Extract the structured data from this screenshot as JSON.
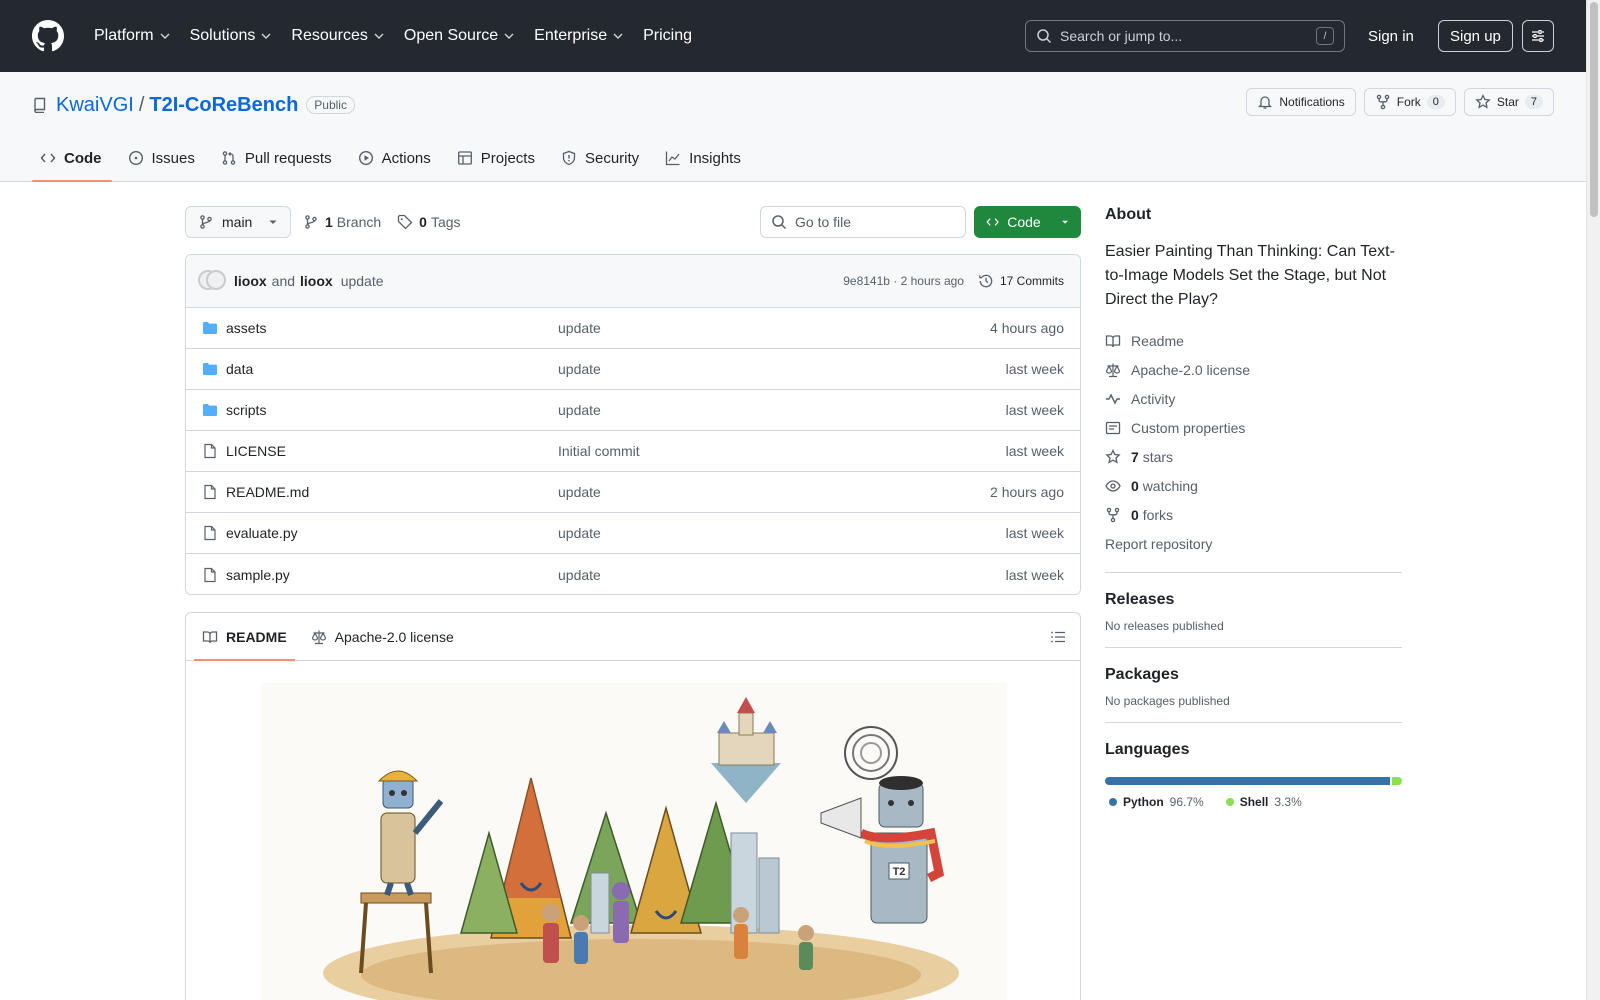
{
  "header": {
    "nav": [
      {
        "label": "Platform",
        "has_menu": true
      },
      {
        "label": "Solutions",
        "has_menu": true
      },
      {
        "label": "Resources",
        "has_menu": true
      },
      {
        "label": "Open Source",
        "has_menu": true
      },
      {
        "label": "Enterprise",
        "has_menu": true
      },
      {
        "label": "Pricing",
        "has_menu": false
      }
    ],
    "search_placeholder": "Search or jump to...",
    "search_key": "/",
    "sign_in": "Sign in",
    "sign_up": "Sign up"
  },
  "repo": {
    "owner": "KwaiVGI",
    "separator": "/",
    "name": "T2I-CoReBench",
    "visibility": "Public",
    "notifications_label": "Notifications",
    "fork_label": "Fork",
    "fork_count": "0",
    "star_label": "Star",
    "star_count": "7",
    "tabs": [
      {
        "label": "Code",
        "icon": "code-icon",
        "active": true
      },
      {
        "label": "Issues",
        "icon": "issue-icon",
        "active": false
      },
      {
        "label": "Pull requests",
        "icon": "pull-request-icon",
        "active": false
      },
      {
        "label": "Actions",
        "icon": "play-icon",
        "active": false
      },
      {
        "label": "Projects",
        "icon": "table-icon",
        "active": false
      },
      {
        "label": "Security",
        "icon": "shield-icon",
        "active": false
      },
      {
        "label": "Insights",
        "icon": "graph-icon",
        "active": false
      }
    ]
  },
  "toolbar": {
    "branch": "main",
    "branch_count": "1",
    "branch_label": "Branch",
    "tag_count": "0",
    "tag_label": "Tags",
    "goto_placeholder": "Go to file",
    "code_button": "Code"
  },
  "commit": {
    "author1": "lioox",
    "and": "and",
    "author2": "lioox",
    "message": "update",
    "hash_time": "9e8141b · 2 hours ago",
    "commits_label": "17 Commits"
  },
  "files": [
    {
      "name": "assets",
      "type": "folder",
      "message": "update",
      "date": "4 hours ago"
    },
    {
      "name": "data",
      "type": "folder",
      "message": "update",
      "date": "last week"
    },
    {
      "name": "scripts",
      "type": "folder",
      "message": "update",
      "date": "last week"
    },
    {
      "name": "LICENSE",
      "type": "file",
      "message": "Initial commit",
      "date": "last week"
    },
    {
      "name": "README.md",
      "type": "file",
      "message": "update",
      "date": "2 hours ago"
    },
    {
      "name": "evaluate.py",
      "type": "file",
      "message": "update",
      "date": "last week"
    },
    {
      "name": "sample.py",
      "type": "file",
      "message": "update",
      "date": "last week"
    }
  ],
  "readme": {
    "tab_readme": "README",
    "tab_license": "Apache-2.0 license",
    "hero_labels": {
      "badge": "T2"
    }
  },
  "about": {
    "heading": "About",
    "description": "Easier Painting Than Thinking: Can Text-to-Image Models Set the Stage, but Not Direct the Play?",
    "links": [
      {
        "icon": "book-icon",
        "label": "Readme",
        "bold": ""
      },
      {
        "icon": "law-icon",
        "label": "Apache-2.0 license",
        "bold": ""
      },
      {
        "icon": "pulse-icon",
        "label": "Activity",
        "bold": ""
      },
      {
        "icon": "note-icon",
        "label": "Custom properties",
        "bold": ""
      },
      {
        "icon": "star-icon",
        "label": "stars",
        "bold": "7"
      },
      {
        "icon": "eye-icon",
        "label": "watching",
        "bold": "0"
      },
      {
        "icon": "fork-icon",
        "label": "forks",
        "bold": "0"
      }
    ],
    "report": "Report repository"
  },
  "releases": {
    "heading": "Releases",
    "empty": "No releases published"
  },
  "packages": {
    "heading": "Packages",
    "empty": "No packages published"
  },
  "languages": {
    "heading": "Languages",
    "items": [
      {
        "name": "Python",
        "percent": "96.7%",
        "value": 96.7,
        "color": "#3572A5"
      },
      {
        "name": "Shell",
        "percent": "3.3%",
        "value": 3.3,
        "color": "#89e051"
      }
    ]
  }
}
